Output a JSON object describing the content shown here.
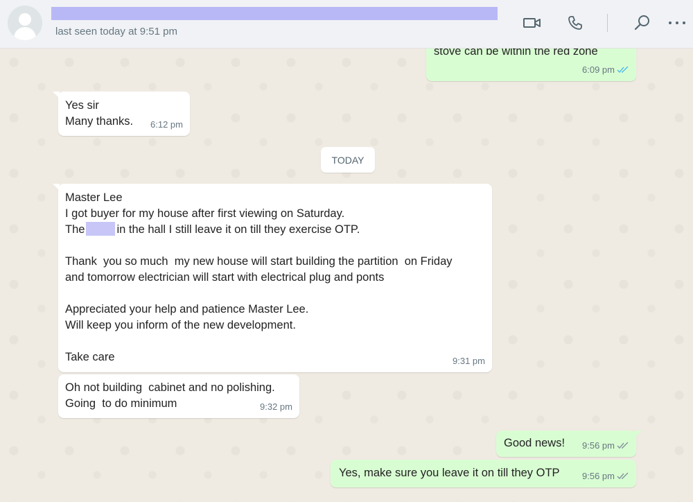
{
  "header": {
    "status": "last seen today at 9:51 pm",
    "icons": [
      "video-call-icon",
      "voice-call-icon",
      "search-icon",
      "more-options-icon"
    ]
  },
  "chat": {
    "date_divider": "TODAY",
    "messages": [
      {
        "dir": "out",
        "text": "stove can be within the red zone",
        "time": "6:09 pm",
        "read": true
      },
      {
        "dir": "in",
        "text": "Yes sir\nMany thanks.",
        "time": "6:12 pm"
      },
      {
        "dir": "in",
        "line1": "Master Lee",
        "line2": "I got buyer for my house after first viewing on Saturday.",
        "line3_a": "The",
        "line3_b": "in the hall I still leave it on till they exercise OTP.",
        "para2": "Thank  you so much  my new house will start building the partition  on Friday\nand tomorrow electrician will start with electrical plug and ponts",
        "para3": "Appreciated your help and patience Master Lee.\nWill keep you inform of the new development.",
        "para4": "Take care",
        "time": "9:31 pm"
      },
      {
        "dir": "in",
        "text": "Oh not building  cabinet and no polishing.\nGoing  to do minimum",
        "time": "9:32 pm"
      },
      {
        "dir": "out",
        "text": "Good news!",
        "time": "9:56 pm",
        "read": true
      },
      {
        "dir": "out",
        "text": "Yes, make sure you leave it on till they OTP",
        "time": "9:56 pm",
        "read": true
      }
    ]
  },
  "colors": {
    "incoming": "#ffffff",
    "outgoing": "#d9fdd3",
    "read_ticks": "#53bdeb",
    "header_bg": "#f0f2f5"
  }
}
